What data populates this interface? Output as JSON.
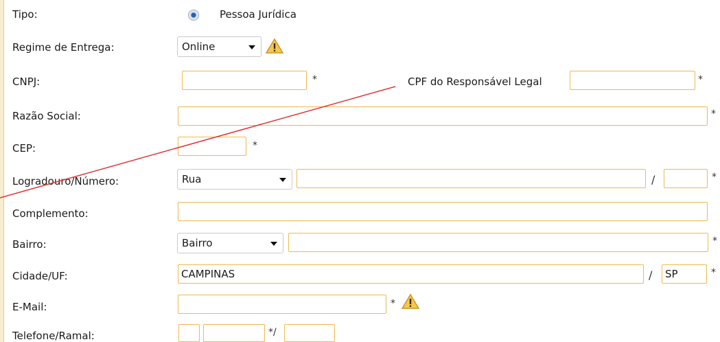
{
  "form": {
    "tipo": {
      "label": "Tipo:",
      "option": "Pessoa Jurídica"
    },
    "regime": {
      "label": "Regime de Entrega:",
      "value": "Online"
    },
    "cnpj": {
      "label": "CNPJ:",
      "value": ""
    },
    "cpf_responsavel": {
      "label": "CPF do Responsável Legal",
      "value": ""
    },
    "razao_social": {
      "label": "Razão Social:",
      "value": ""
    },
    "cep": {
      "label": "CEP:",
      "value": ""
    },
    "logradouro": {
      "label": "Logradouro/Número:",
      "tipo": "Rua",
      "value": "",
      "numero": ""
    },
    "complemento": {
      "label": "Complemento:",
      "value": ""
    },
    "bairro": {
      "label": "Bairro:",
      "tipo": "Bairro",
      "value": ""
    },
    "cidade": {
      "label": "Cidade/UF:",
      "value": "CAMPINAS",
      "uf": "SP"
    },
    "email": {
      "label": "E-Mail:",
      "value": ""
    },
    "telefone": {
      "label": "Telefone/Ramal:",
      "ddd": "",
      "numero": "",
      "ramal": ""
    }
  },
  "symbols": {
    "required": "*",
    "slash": "/",
    "required_slash": "*/"
  },
  "colors": {
    "field_border": "#f0b84c",
    "annotation_line": "#e0322f",
    "radio_selected": "#1f5fbf"
  },
  "icons": {
    "warning": "warning-icon",
    "radio": "radio-selected-icon",
    "dropdown": "chevron-down-icon"
  }
}
